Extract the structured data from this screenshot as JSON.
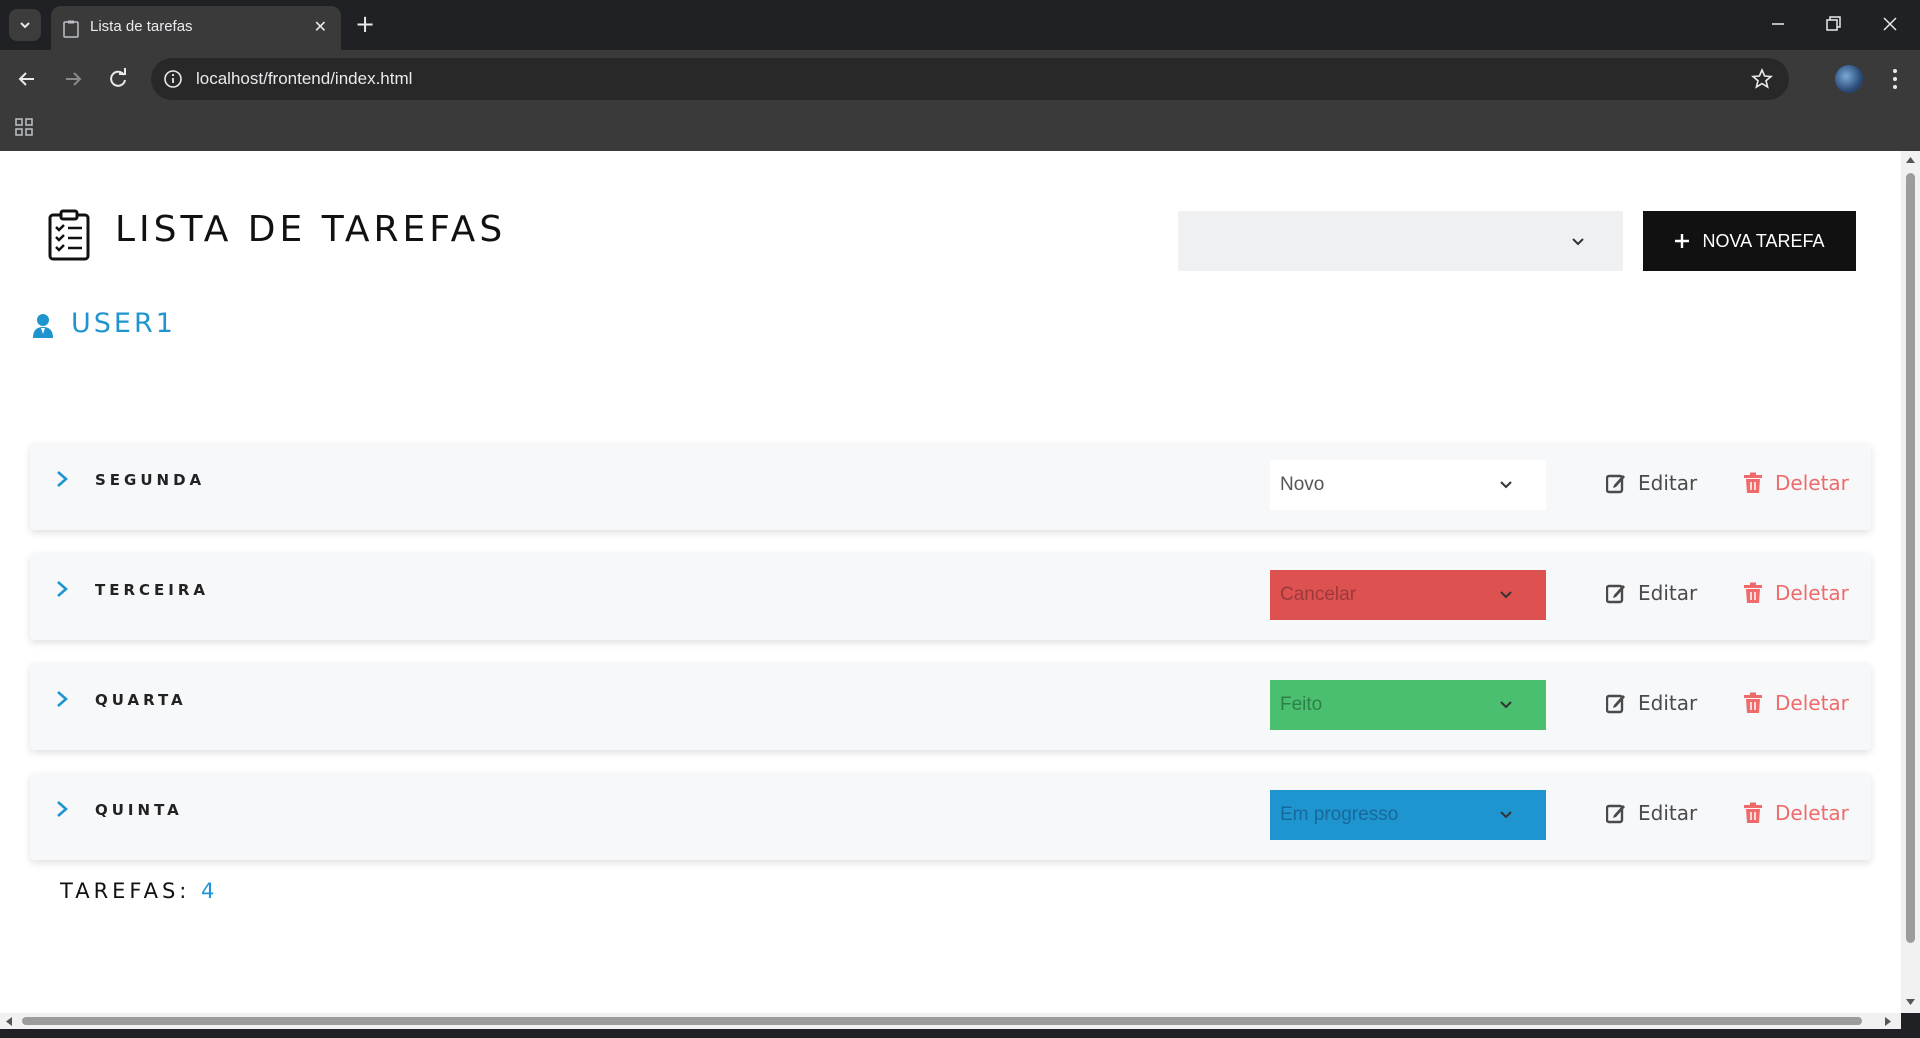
{
  "browser": {
    "tab_title": "Lista de tarefas",
    "tab_close": "✕",
    "new_tab": "+",
    "url": "localhost/frontend/index.html"
  },
  "app": {
    "title": "LISTA DE TAREFAS",
    "filter_value": "",
    "new_task_label": "NOVA TAREFA",
    "user": "USER1",
    "count_label": "TAREFAS:",
    "count_value": "4"
  },
  "tasks": [
    {
      "name": "SEGUNDA",
      "status": "Novo",
      "status_color": "#ffffff",
      "status_text_color": "#555555",
      "edit": "Editar",
      "delete": "Deletar"
    },
    {
      "name": "TERCEIRA",
      "status": "Cancelar",
      "status_color": "#de5151",
      "status_text_color": "#9c3a3a",
      "edit": "Editar",
      "delete": "Deletar"
    },
    {
      "name": "QUARTA",
      "status": "Feito",
      "status_color": "#49bf6f",
      "status_text_color": "#2e8049",
      "edit": "Editar",
      "delete": "Deletar"
    },
    {
      "name": "QUINTA",
      "status": "Em progresso",
      "status_color": "#1f95cf",
      "status_text_color": "#16699a",
      "edit": "Editar",
      "delete": "Deletar"
    }
  ],
  "colors": {
    "accent": "#1f95cf",
    "delete": "#ef6b6b",
    "button_dark": "#111111"
  }
}
